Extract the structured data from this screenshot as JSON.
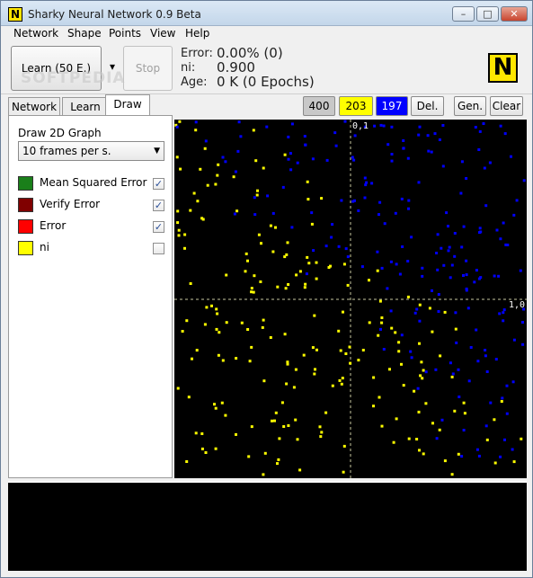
{
  "window": {
    "title": "Sharky Neural Network 0.9 Beta",
    "icon_letter": "N",
    "minimize": "–",
    "maximize": "□",
    "close": "✕"
  },
  "menu": [
    "Network",
    "Shape",
    "Points",
    "View",
    "Help"
  ],
  "toolbar": {
    "learn_button": "Learn (50 E.)",
    "learn_dropdown": "▾",
    "stop_button": "Stop",
    "error_label": "Error:",
    "error_value": "0.00% (0)",
    "ni_label": "ni:",
    "ni_value": "0.900",
    "age_label": "Age:",
    "age_value": "0 K (0 Epochs)",
    "logo_letter": "N"
  },
  "tabs": [
    {
      "label": "Network"
    },
    {
      "label": "Learn"
    },
    {
      "label": "Draw",
      "active": true
    }
  ],
  "draw_panel": {
    "title": "Draw 2D Graph",
    "frames_select": "10 frames per s.",
    "legend": [
      {
        "label": "Mean Squared Error",
        "color": "#1a7f1a",
        "checked": true
      },
      {
        "label": "Verify Error",
        "color": "#800000",
        "checked": true
      },
      {
        "label": "Error",
        "color": "#ff0000",
        "checked": true
      },
      {
        "label": "ni",
        "color": "#ffff00",
        "checked": false
      }
    ]
  },
  "point_controls": {
    "total": "400",
    "yellow_count": "203",
    "blue_count": "197",
    "delete": "Del.",
    "generate": "Gen.",
    "clear": "Clear",
    "yellow_color": "#ffff00",
    "blue_color": "#0000ff"
  },
  "plot": {
    "y_axis_label": "0,1",
    "x_axis_label": "1,0",
    "background": "#000000"
  },
  "watermark": "SOFTPEDIA"
}
